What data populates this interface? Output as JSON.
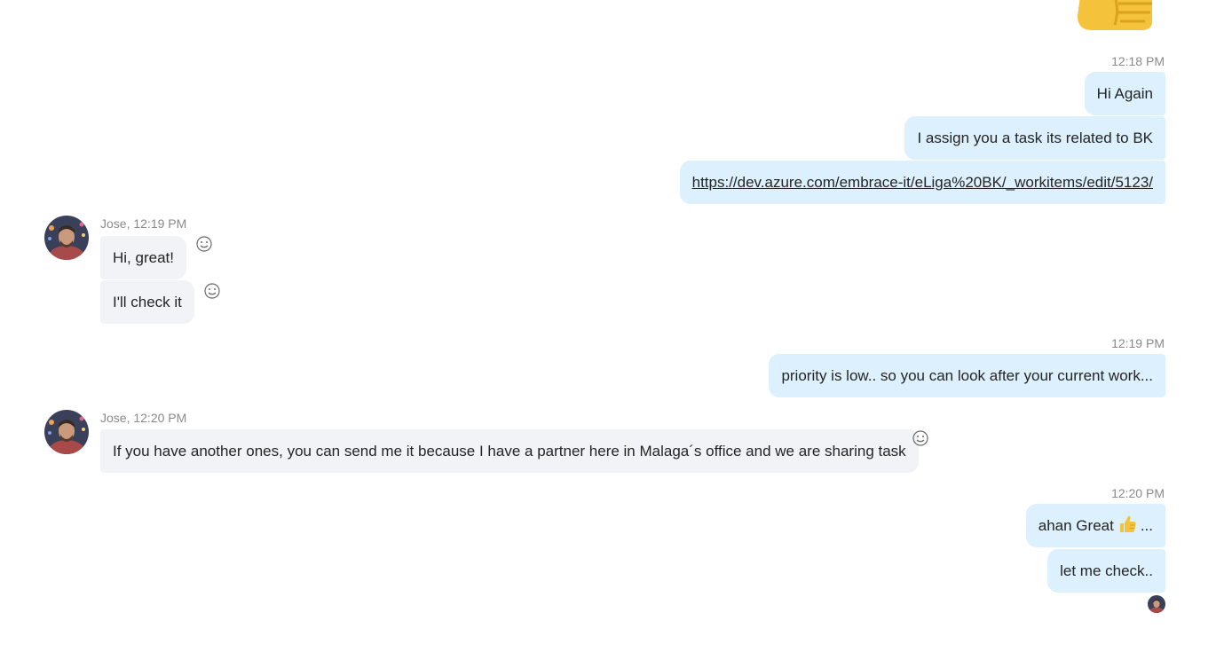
{
  "messages": {
    "g1": {
      "time": "12:18 PM",
      "m1": "Hi Again",
      "m2": "I assign you a task its related to BK",
      "m3": "https://dev.azure.com/embrace-it/eLiga%20BK/_workitems/edit/5123/"
    },
    "g2": {
      "sender_time": "Jose, 12:19 PM",
      "m1": "Hi, great!",
      "m2": "I'll check it"
    },
    "g3": {
      "time": "12:19 PM",
      "m1": "priority is low.. so you can look after your current work..."
    },
    "g4": {
      "sender_time": "Jose, 12:20 PM",
      "m1": "If you have another ones, you can send me it because I have a partner here in Malaga´s office and we are sharing task"
    },
    "g5": {
      "time": "12:20 PM",
      "m1_before": "ahan Great",
      "m1_emoji": "thumbs-up-emoji",
      "m1_after": "...",
      "m2": "let me check.."
    }
  },
  "colors": {
    "outgoing_bubble": "#dcf0fd",
    "incoming_bubble": "#f1f3f6",
    "timestamp": "#8a8a8a",
    "emoji_yellow": "#f5c33b"
  }
}
